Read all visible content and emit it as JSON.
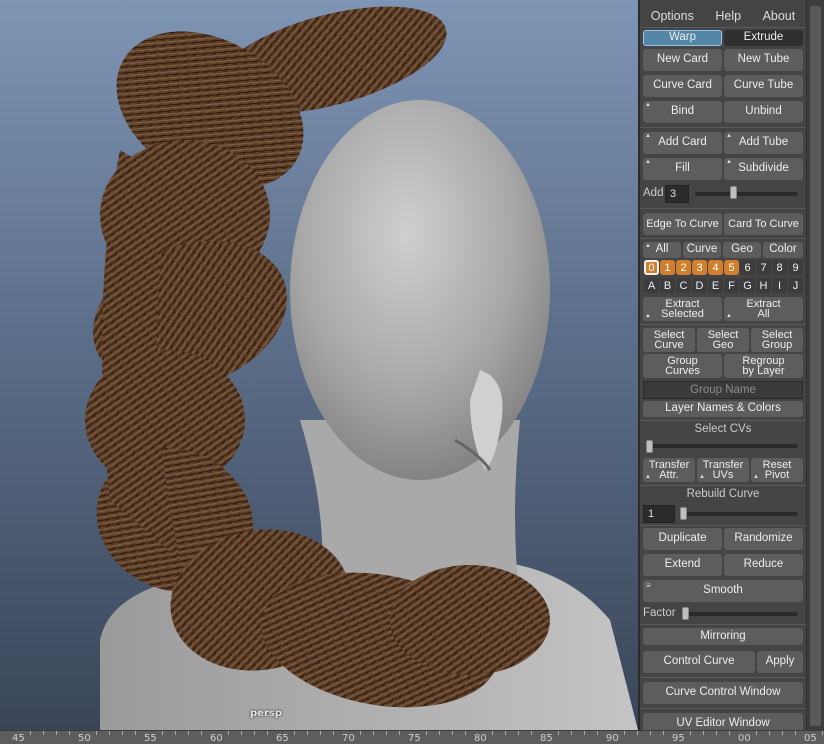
{
  "viewport": {
    "camera": "persp"
  },
  "timeline": {
    "ticks": [
      "45",
      "50",
      "55",
      "60",
      "65",
      "70",
      "75",
      "80",
      "85",
      "90",
      "95",
      "00",
      "05"
    ]
  },
  "menu": {
    "options": "Options",
    "help": "Help",
    "about": "About"
  },
  "mode": {
    "warp": "Warp",
    "extrude": "Extrude",
    "selected": "Warp"
  },
  "create": {
    "new_card": "New Card",
    "new_tube": "New Tube",
    "curve_card": "Curve Card",
    "curve_tube": "Curve Tube",
    "bind": "Bind",
    "unbind": "Unbind"
  },
  "add": {
    "add_card": "Add Card",
    "add_tube": "Add Tube",
    "fill": "Fill",
    "subdivide": "Subdivide",
    "add_label": "Add",
    "add_value": "3",
    "add_slider_fraction": 0.5
  },
  "convert": {
    "edge_to_curve": "Edge To Curve",
    "card_to_curve": "Card To Curve"
  },
  "filter": {
    "all": "All",
    "curve": "Curve",
    "geo": "Geo",
    "color": "Color"
  },
  "layers": {
    "numbers": [
      "0",
      "1",
      "2",
      "3",
      "4",
      "5",
      "6",
      "7",
      "8",
      "9"
    ],
    "letters": [
      "A",
      "B",
      "C",
      "D",
      "E",
      "F",
      "G",
      "H",
      "I",
      "J"
    ],
    "active_layer": "0",
    "used_layers": [
      "0",
      "1",
      "2",
      "3",
      "4",
      "5"
    ]
  },
  "extract": {
    "selected_l1": "Extract",
    "selected_l2": "Selected",
    "all_l1": "Extract",
    "all_l2": "All"
  },
  "select": {
    "curve_l1": "Select",
    "curve_l2": "Curve",
    "geo_l1": "Select",
    "geo_l2": "Geo",
    "group_l1": "Select",
    "group_l2": "Group"
  },
  "group": {
    "curves_l1": "Group",
    "curves_l2": "Curves",
    "regroup_l1": "Regroup",
    "regroup_l2": "by Layer",
    "name_placeholder": "Group Name",
    "layer_names": "Layer Names & Colors"
  },
  "cvs": {
    "label": "Select CVs",
    "slider_fraction": 0.0
  },
  "transfer": {
    "attr_l1": "Transfer",
    "attr_l2": "Attr.",
    "uvs_l1": "Transfer",
    "uvs_l2": "UVs",
    "reset_l1": "Reset",
    "reset_l2": "Pivot"
  },
  "rebuild": {
    "label": "Rebuild Curve",
    "value": "1",
    "slider_fraction": 0.0
  },
  "tools": {
    "duplicate": "Duplicate",
    "randomize": "Randomize",
    "extend": "Extend",
    "reduce": "Reduce",
    "smooth": "Smooth",
    "factor_label": "Factor",
    "factor_fraction": 0.0
  },
  "windows": {
    "mirroring": "Mirroring",
    "control_curve": "Control Curve",
    "apply": "Apply",
    "curve_control_window": "Curve Control Window",
    "uv_editor_window": "UV Editor Window"
  }
}
